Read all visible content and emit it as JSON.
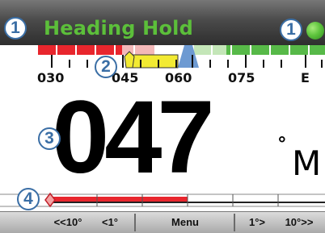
{
  "header": {
    "mode_title": "Heading Hold",
    "status_color": "#5fc53e"
  },
  "callouts": [
    "1",
    "1",
    "2",
    "3",
    "4"
  ],
  "compass": {
    "labels": [
      "030",
      "045",
      "060",
      "075",
      "E"
    ],
    "port_color": "#e8262d",
    "starboard_color": "#57b948",
    "course_error_color": "#f2ea32",
    "pointer_color": "#6d9ad2"
  },
  "heading": {
    "value": "047",
    "degree_symbol": "°",
    "reference": "M"
  },
  "rudder": {
    "bar_color": "#e8262d"
  },
  "softkeys": {
    "port_10": "<<10°",
    "port_1": "<1°",
    "menu": "Menu",
    "stbd_1": "1°>",
    "stbd_10": "10°>>"
  }
}
